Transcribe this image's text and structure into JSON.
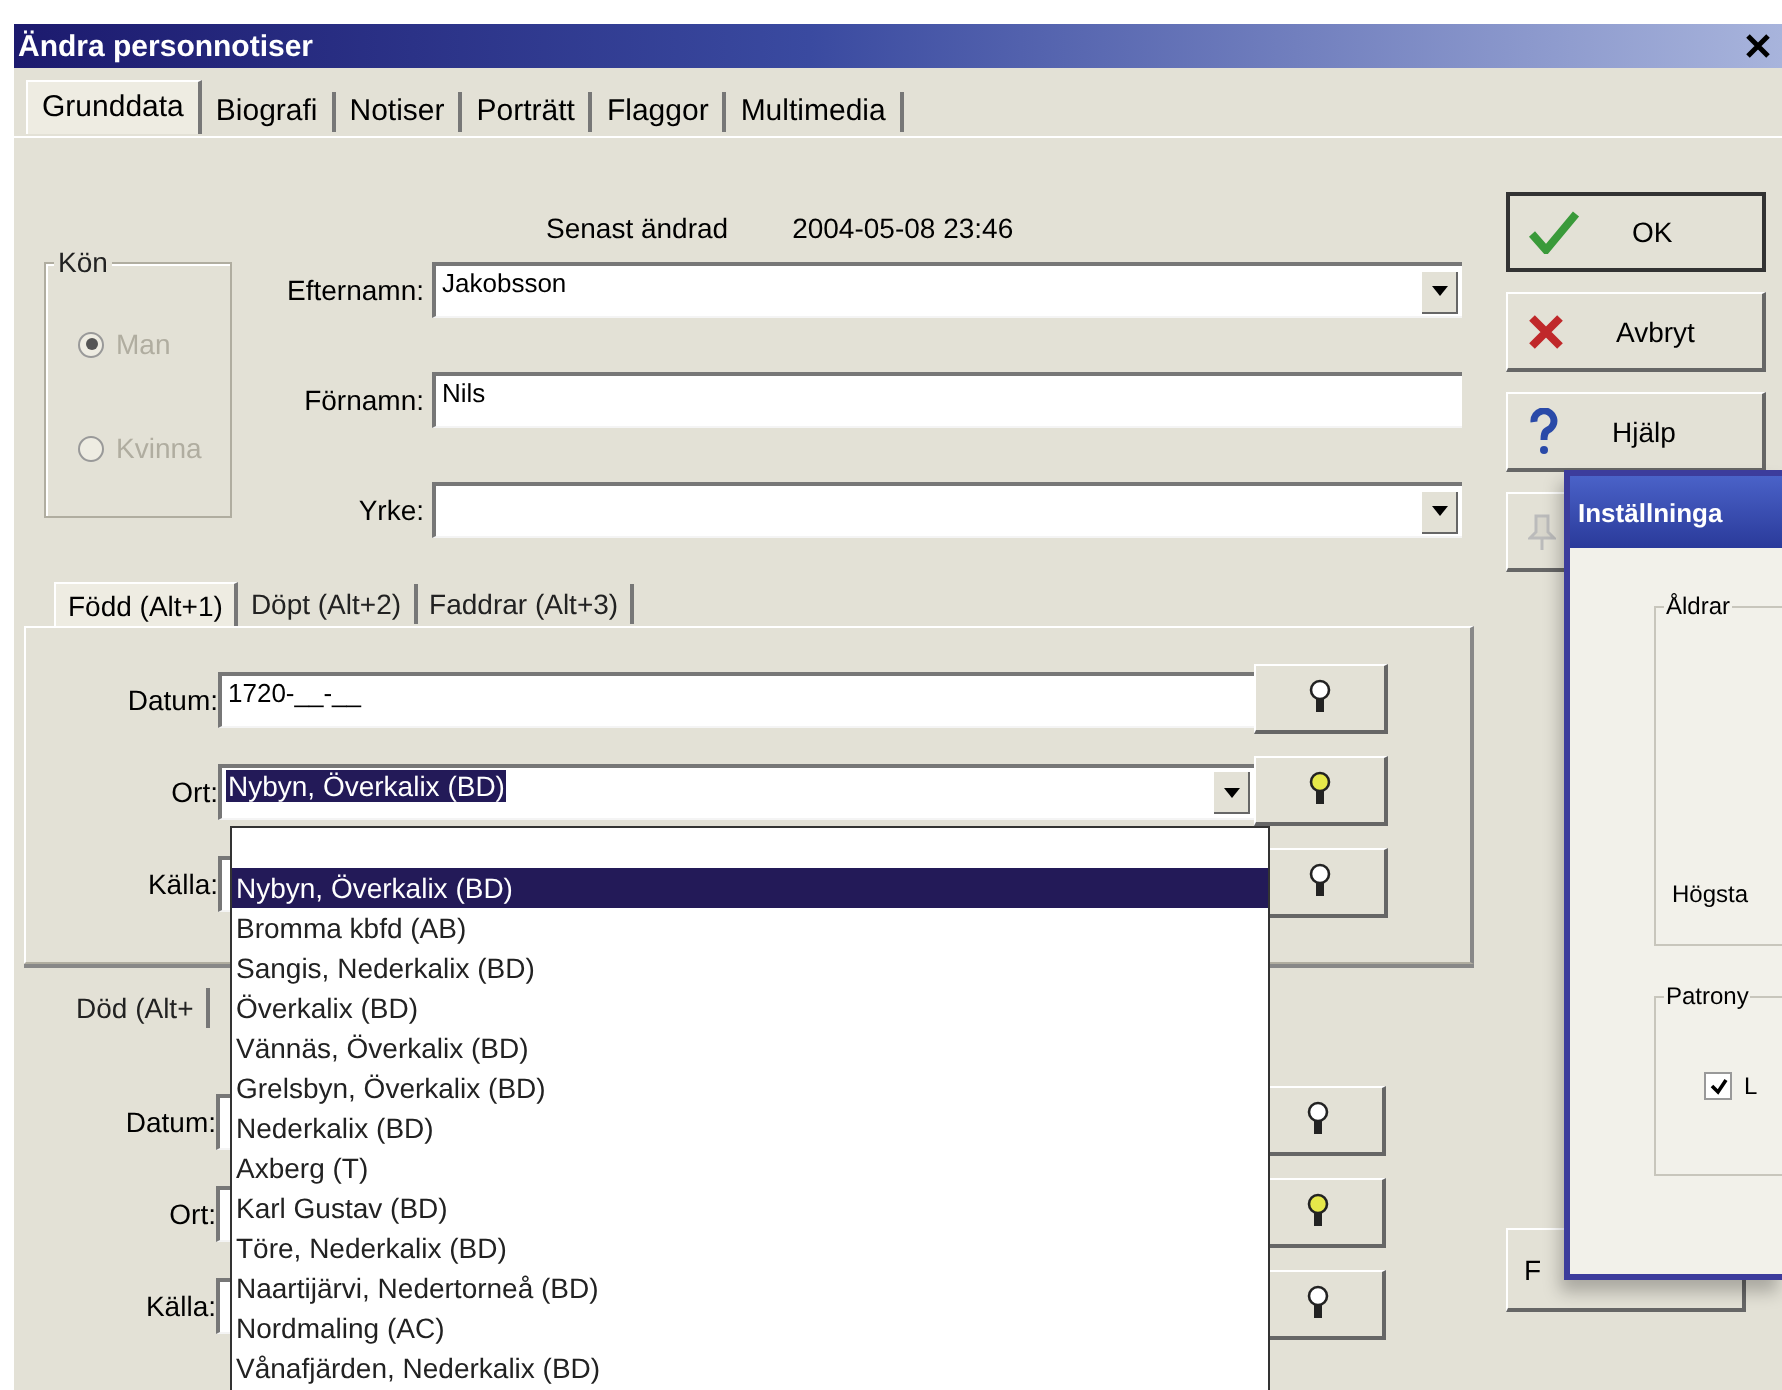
{
  "window": {
    "title": "Ändra personnotiser"
  },
  "tabs": [
    {
      "label": "Grunddata",
      "selected": true
    },
    {
      "label": "Biografi",
      "selected": false
    },
    {
      "label": "Notiser",
      "selected": false
    },
    {
      "label": "Porträtt",
      "selected": false
    },
    {
      "label": "Flaggor",
      "selected": false
    },
    {
      "label": "Multimedia",
      "selected": false
    }
  ],
  "last_changed": {
    "label": "Senast ändrad",
    "value": "2004-05-08 23:46"
  },
  "gender": {
    "title": "Kön",
    "disabled": true,
    "options": [
      {
        "label": "Man",
        "selected": true
      },
      {
        "label": "Kvinna",
        "selected": false
      }
    ]
  },
  "fields": [
    {
      "label": "Efternamn:",
      "value": "Jakobsson",
      "kind": "combo"
    },
    {
      "label": "Förnamn:",
      "value": "Nils",
      "kind": "text"
    },
    {
      "label": "Yrke:",
      "kind": "combo"
    }
  ],
  "buttons": [
    {
      "label": "OK",
      "kind": "ok"
    },
    {
      "label": "Avbryt",
      "kind": "cancel"
    },
    {
      "label": "Hjälp",
      "kind": "help"
    },
    {
      "kind": "pin"
    }
  ],
  "event_tabs": [
    {
      "label": "Född  (Alt+1)",
      "selected": true
    },
    {
      "label": "Döpt  (Alt+2)",
      "selected": false
    },
    {
      "label": "Faddrar  (Alt+3)",
      "selected": false
    }
  ],
  "born": {
    "fields": [
      {
        "label": "Datum:",
        "value": "1720-__-__",
        "kind": "text",
        "bulb_lit": false
      },
      {
        "label": "Ort:",
        "value": "Nybyn, Överkalix (BD)",
        "kind": "combo",
        "highlighted": true,
        "bulb_lit": true
      },
      {
        "label": "Källa:",
        "kind": "text",
        "bulb_lit": false
      }
    ]
  },
  "death": {
    "tab": "Död  (Alt+",
    "fields": [
      {
        "label": "Datum:",
        "bulb_lit": false
      },
      {
        "label": "Ort:",
        "bulb_lit": true
      },
      {
        "label": "Källa:",
        "bulb_lit": false
      }
    ]
  },
  "place_dropdown": {
    "blank_first_row": true,
    "items": [
      {
        "label": "Nybyn, Överkalix (BD)",
        "selected": true
      },
      {
        "label": "Bromma kbfd (AB)",
        "selected": false
      },
      {
        "label": "Sangis, Nederkalix (BD)",
        "selected": false
      },
      {
        "label": "Överkalix (BD)",
        "selected": false
      },
      {
        "label": "Vännäs, Överkalix (BD)",
        "selected": false
      },
      {
        "label": "Grelsbyn, Överkalix (BD)",
        "selected": false
      },
      {
        "label": "Nederkalix (BD)",
        "selected": false
      },
      {
        "label": "Axberg (T)",
        "selected": false
      },
      {
        "label": "Karl Gustav (BD)",
        "selected": false
      },
      {
        "label": "Töre, Nederkalix (BD)",
        "selected": false
      },
      {
        "label": "Naartijärvi, Nedertorneå (BD)",
        "selected": false
      },
      {
        "label": "Nordmaling (AC)",
        "selected": false
      },
      {
        "label": "Vånafjärden, Nederkalix (BD)",
        "selected": false
      }
    ]
  },
  "side_button": "F",
  "settings_window": {
    "title": "Inställninga",
    "ages_group": {
      "title": "Åldrar",
      "text": "Högsta"
    },
    "patronym_group": {
      "title": "Patrony",
      "checkbox": {
        "label": "L",
        "checked": true
      }
    }
  }
}
